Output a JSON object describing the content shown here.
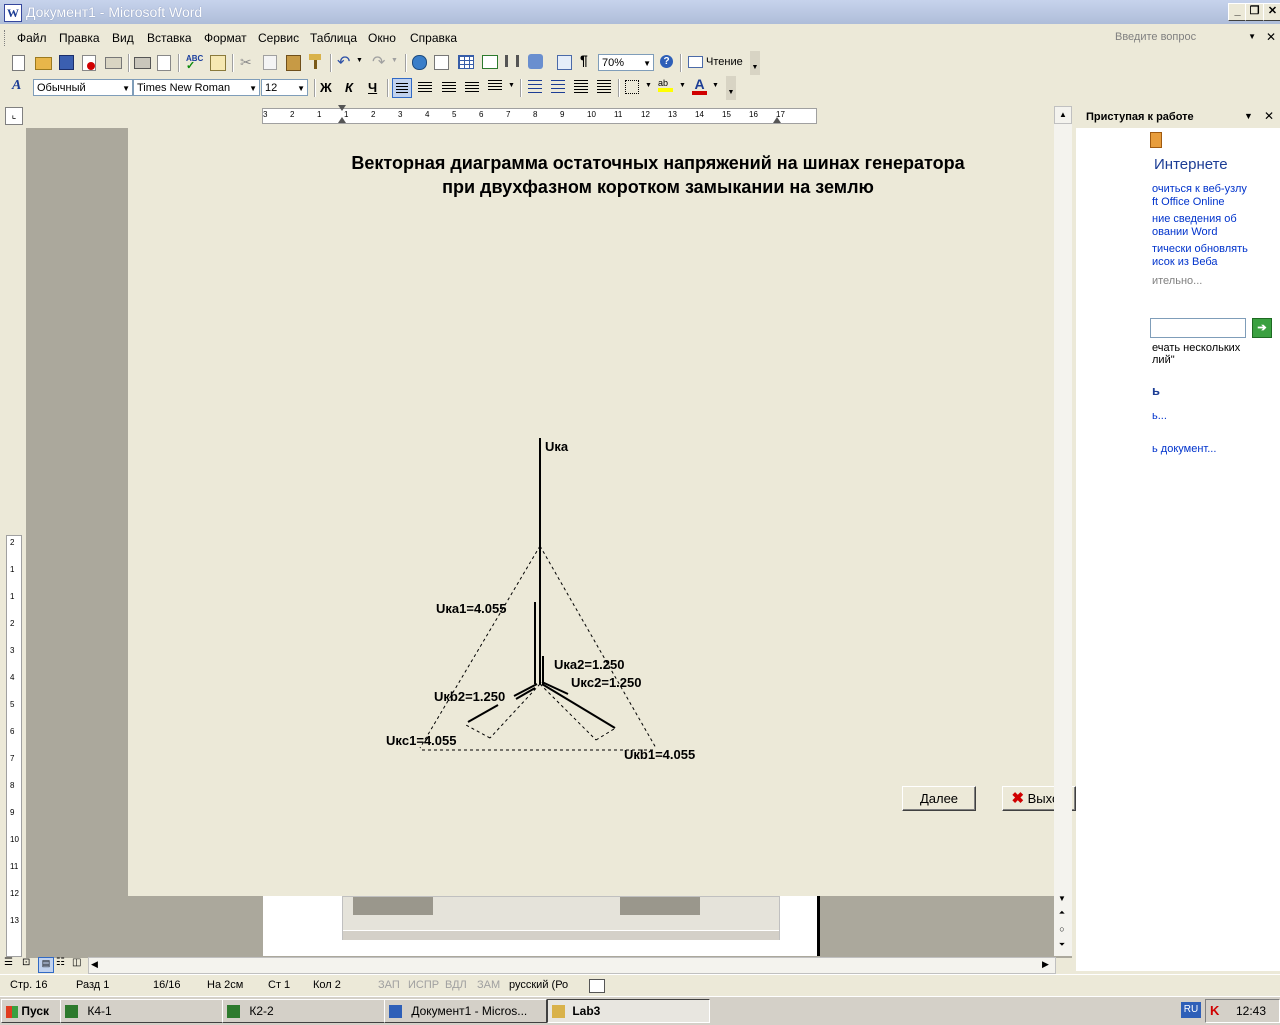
{
  "window": {
    "title": "Документ1 - Microsoft Word"
  },
  "menu": {
    "items": [
      "Файл",
      "Правка",
      "Вид",
      "Вставка",
      "Формат",
      "Сервис",
      "Таблица",
      "Окно",
      "Справка"
    ],
    "help_placeholder": "Введите вопрос"
  },
  "toolbar": {
    "zoom": "70%",
    "reading_label": "Чтение",
    "style": "Обычный",
    "font": "Times New Roman",
    "size": "12",
    "bold": "Ж",
    "italic": "К",
    "underline": "Ч"
  },
  "ruler": {
    "marks": [
      "3",
      "2",
      "1",
      "1",
      "2",
      "3",
      "4",
      "5",
      "6",
      "7",
      "8",
      "9",
      "10",
      "11",
      "12",
      "13",
      "14",
      "15",
      "16",
      "17"
    ],
    "vertical_marks": [
      "2",
      "1",
      "1",
      "2",
      "3",
      "4",
      "5",
      "6",
      "7",
      "8",
      "9",
      "10",
      "11",
      "12",
      "13"
    ]
  },
  "diagram": {
    "title_line1": "Векторная диаграмма остаточных напряжений на шинах генератора",
    "title_line2": "при двухфазном коротком замыкании на землю",
    "labels": {
      "uka": "Uкa",
      "uka1": "Uкa1=4.055",
      "uka2": "Uкa2=1.250",
      "ukc2": "Uкc2=1.250",
      "ukb2": "Uкb2=1.250",
      "ukc1": "Uкc1=4.055",
      "ukb1": "Uкb1=4.055"
    },
    "next_button": "Далее",
    "exit_button": "Выход"
  },
  "taskpane": {
    "title": "Приступая к работе",
    "section": "Интернете",
    "links": [
      "очиться к веб-узлу",
      "ft Office Online",
      "ние сведения об",
      "овании Word",
      "тически обновлять",
      "исок из Веба"
    ],
    "more": "ительно...",
    "search_hint_1": "ечать нескольких",
    "search_hint_2": "лий\"",
    "section2": "ь",
    "open_link": "ь...",
    "create_link": "ь документ..."
  },
  "statusbar": {
    "page": "Стр. 16",
    "section": "Разд 1",
    "pages": "16/16",
    "at": "На 2см",
    "line": "Ст 1",
    "col": "Кол 2",
    "rec": "ЗАП",
    "trk": "ИСПР",
    "ext": "ВДЛ",
    "ovr": "ЗАМ",
    "lang": "русский (Ро"
  },
  "taskbar": {
    "start": "Пуск",
    "tasks": [
      "К4-1",
      "К2-2",
      "Документ1 - Micros...",
      "Lab3"
    ],
    "lang": "RU",
    "clock": "12:43"
  },
  "colors": {
    "title_bg": "#aebdd9",
    "accent_red": "#d00000",
    "link": "#0033cc"
  }
}
